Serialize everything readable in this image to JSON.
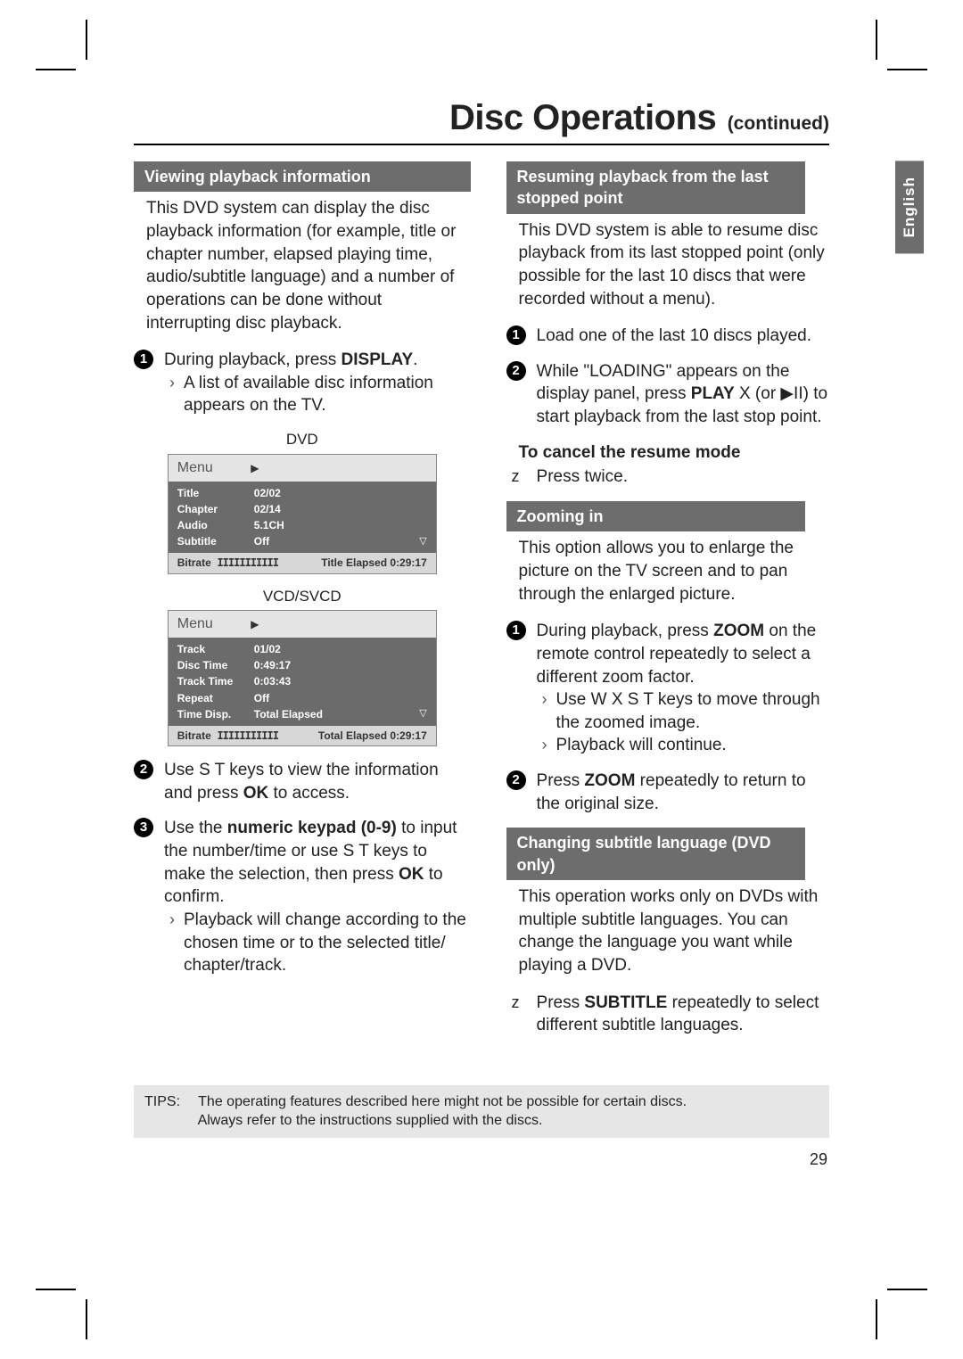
{
  "page_number": "29",
  "language_tab": "English",
  "title_main": "Disc Operations",
  "title_sub": "(continued)",
  "sections": {
    "viewing": {
      "head": "Viewing playback information",
      "intro": "This DVD system can display the disc playback information (for example, title or chapter number, elapsed playing time, audio/subtitle language) and a number of operations can be done without interrupting disc playback.",
      "step1_pre": "During playback, press ",
      "step1_bold": "DISPLAY",
      "step1_post": ".",
      "step1_note": "A list of available disc information appears on the TV.",
      "dvd_label": "DVD",
      "dvd_menu": {
        "header": "Menu",
        "rows": [
          {
            "k": "Title",
            "v": "02/02"
          },
          {
            "k": "Chapter",
            "v": "02/14"
          },
          {
            "k": "Audio",
            "v": "5.1CH"
          },
          {
            "k": "Subtitle",
            "v": "Off"
          }
        ],
        "footer_left": "Bitrate",
        "footer_bars": "IIIIIIIIIII",
        "footer_right_label": "Title Elapsed",
        "footer_right_val": "0:29:17"
      },
      "vcd_label": "VCD/SVCD",
      "vcd_menu": {
        "header": "Menu",
        "rows": [
          {
            "k": "Track",
            "v": "01/02"
          },
          {
            "k": "Disc Time",
            "v": "0:49:17"
          },
          {
            "k": "Track Time",
            "v": "0:03:43"
          },
          {
            "k": "Repeat",
            "v": "Off"
          },
          {
            "k": "Time Disp.",
            "v": "Total Elapsed"
          }
        ],
        "footer_left": "Bitrate",
        "footer_bars": "IIIIIIIIIII",
        "footer_right_label": "Total Elapsed",
        "footer_right_val": "0:29:17"
      },
      "step2_pre": "Use  S T  keys to view the information and press ",
      "step2_bold": "OK",
      "step2_post": " to access.",
      "step3_pre": "Use the ",
      "step3_bold1": "numeric keypad (0-9)",
      "step3_mid": " to input the number/time or use  S T  keys to make the selection, then press ",
      "step3_bold2": "OK",
      "step3_post": " to confirm.",
      "step3_note": "Playback will change according to the chosen time or to the selected title/ chapter/track."
    },
    "resuming": {
      "head": "Resuming playback from the last stopped point",
      "intro": "This DVD system is able to resume disc playback from its last stopped point (only possible for the last 10 discs that were recorded without a menu).",
      "step1": "Load one of the last 10 discs played.",
      "step2_pre": "While \"LOADING\" appears on the display panel, press ",
      "step2_bold": "PLAY",
      "step2_post": "  X (or ▶II) to start playback from the last stop point.",
      "cancel_head": "To cancel the resume mode",
      "cancel_body_pre": "Press  ",
      "cancel_body_post": "  twice."
    },
    "zoom": {
      "head": "Zooming in",
      "intro": "This option allows you to enlarge the picture on the TV screen and to pan through the enlarged picture.",
      "step1_pre": "During playback, press ",
      "step1_bold": "ZOOM",
      "step1_post": " on the remote control repeatedly to select a different zoom factor.",
      "step1_note1": "Use  W X S T keys to move through the zoomed image.",
      "step1_note2": "Playback will continue.",
      "step2_pre": "Press ",
      "step2_bold": "ZOOM",
      "step2_post": " repeatedly to return to the original size."
    },
    "subtitle": {
      "head": "Changing subtitle language (DVD only)",
      "intro": "This operation works only on DVDs with multiple subtitle languages. You can change the language you want while playing a DVD.",
      "step_pre": "Press ",
      "step_bold": "SUBTITLE",
      "step_post": " repeatedly to select different subtitle languages."
    }
  },
  "tips": {
    "label": "TIPS:",
    "line1": "The operating features described here might not be possible for certain discs.",
    "line2": "Always refer to the instructions supplied with the discs."
  }
}
